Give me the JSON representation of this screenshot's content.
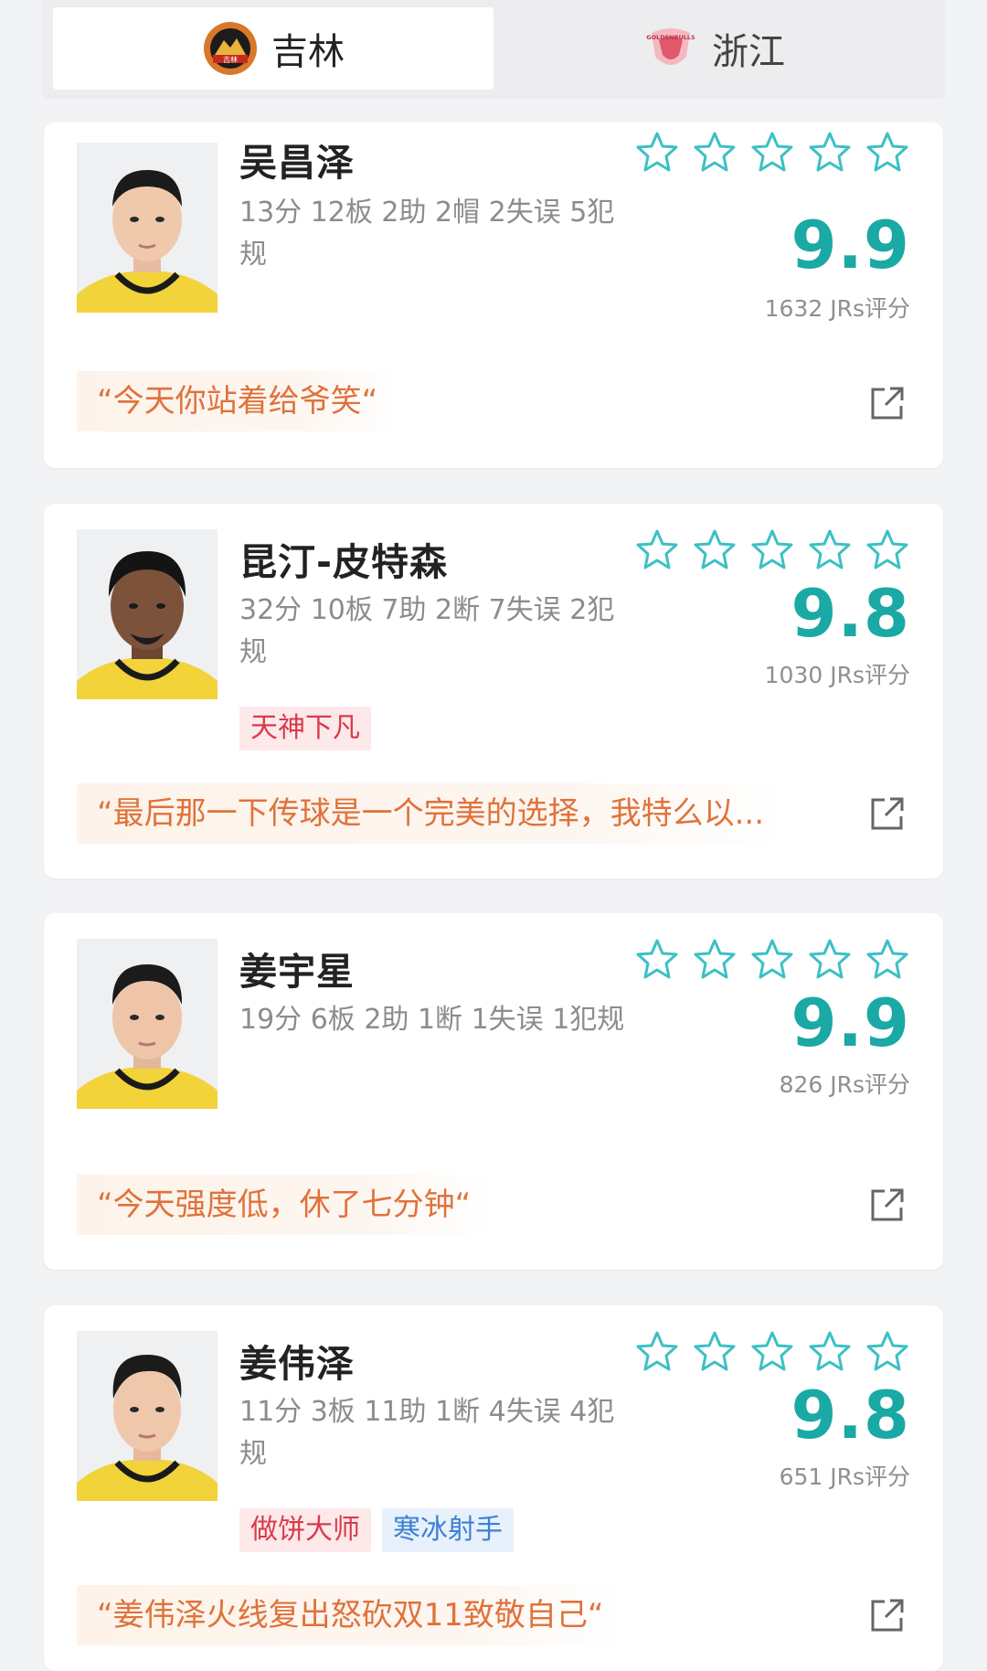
{
  "tabs": [
    {
      "label": "吉林",
      "active": true,
      "logo": "jilin-team-logo",
      "logo_text": "吉林"
    },
    {
      "label": "浙江",
      "active": false,
      "logo": "zhejiang-golden-bulls-logo",
      "logo_text": "GOLDENBULLS"
    }
  ],
  "colors": {
    "accent": "#1aa9a4",
    "quote": "#e0723a",
    "tag_red": "#d93b49",
    "tag_blue": "#3c7fd3"
  },
  "players": [
    {
      "name": "吴昌泽",
      "stats": "13分 12板 2助 2帽 2失误 5犯规",
      "tags": [],
      "score": "9.9",
      "votes": "1632 JRs评分",
      "quote": "“今天你站着给爷笑“"
    },
    {
      "name": "昆汀-皮特森",
      "stats": "32分 10板 7助 2断 7失误 2犯规",
      "tags": [
        "天神下凡"
      ],
      "score": "9.8",
      "votes": "1030 JRs评分",
      "quote": "“最后那一下传球是一个完美的选择，我特么以..."
    },
    {
      "name": "姜宇星",
      "stats": "19分 6板 2助 1断 1失误 1犯规",
      "tags": [],
      "score": "9.9",
      "votes": "826 JRs评分",
      "quote": "“今天强度低，休了七分钟“"
    },
    {
      "name": "姜伟泽",
      "stats": "11分 3板 11助 1断 4失误 4犯规",
      "tags": [
        "做饼大师",
        "寒冰射手"
      ],
      "score": "9.8",
      "votes": "651 JRs评分",
      "quote": "“姜伟泽火线复出怒砍双11致敬自己“"
    }
  ]
}
